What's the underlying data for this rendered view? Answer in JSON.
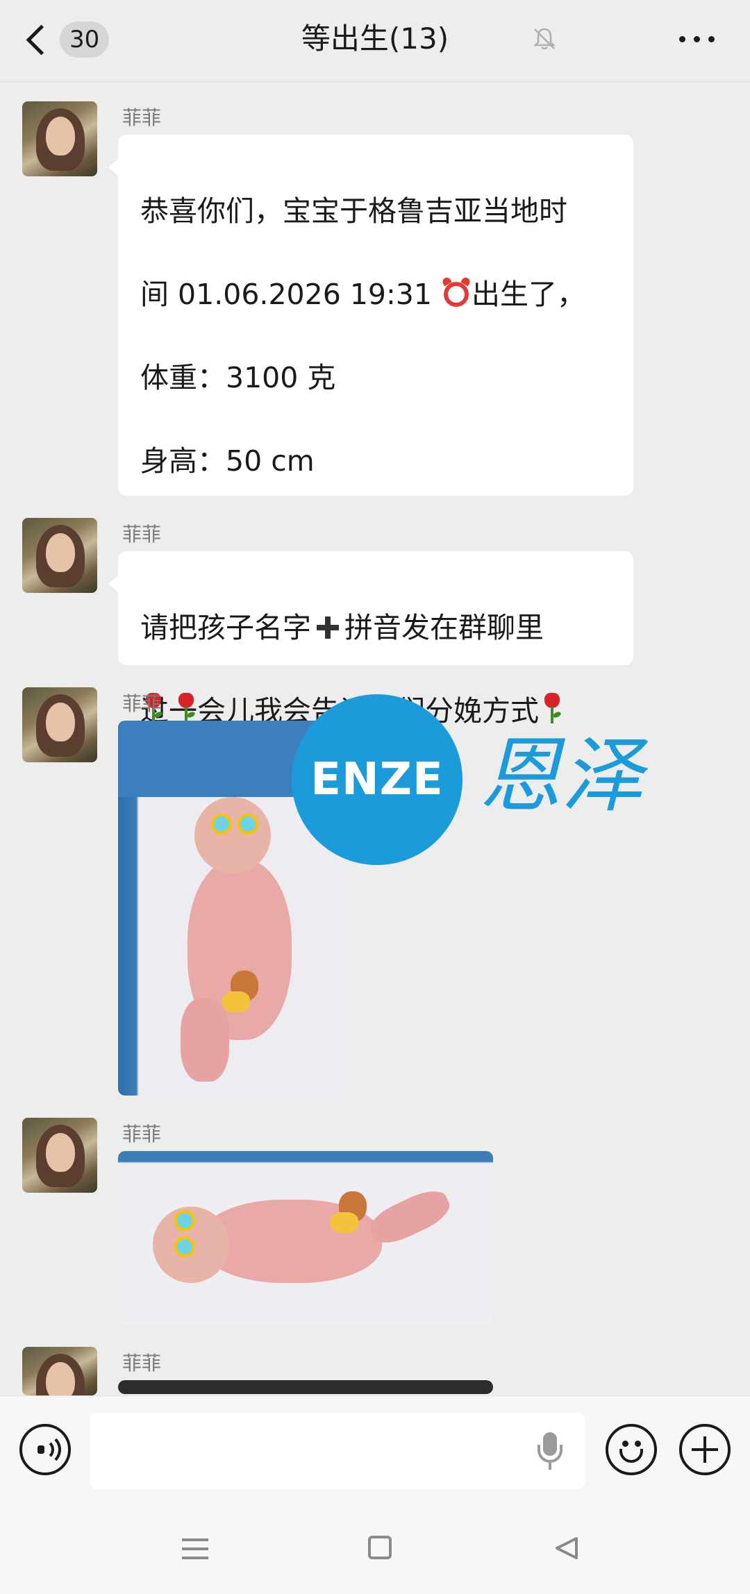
{
  "header": {
    "unread_count": "30",
    "title": "等出生(13)"
  },
  "messages": [
    {
      "sender": "菲菲",
      "type": "text",
      "lines": [
        "恭喜你们，宝宝于格鲁吉亚当地时",
        "间 01.06.2026 19:31",
        "出生了，",
        "体重：3100 克",
        "身高：50 cm",
        "过一会儿我会告诉你们分娩方式"
      ]
    },
    {
      "sender": "菲菲",
      "type": "text",
      "lines": [
        "请把孩子名字",
        "拼音发在群聊里"
      ]
    },
    {
      "sender": "菲菲",
      "type": "image",
      "alt": "newborn-photo-portrait"
    },
    {
      "sender": "菲菲",
      "type": "image",
      "alt": "newborn-photo-landscape"
    },
    {
      "sender": "菲菲",
      "type": "image",
      "alt": "newborn-photo-partial"
    }
  ],
  "watermark": {
    "circle_text": "ENZE",
    "chinese_text": "恩泽",
    "color": "#1b9bd9"
  },
  "input": {
    "value": "",
    "placeholder": ""
  },
  "icons": {
    "back": "chevron-left-icon",
    "mute": "bell-muted-icon",
    "more": "ellipsis-icon",
    "voice": "voice-icon",
    "mic": "mic-icon",
    "emoji": "smiley-icon",
    "plus": "plus-circle-icon"
  },
  "colors": {
    "background": "#ededed",
    "bubble": "#ffffff",
    "text": "#1a1a1a"
  }
}
